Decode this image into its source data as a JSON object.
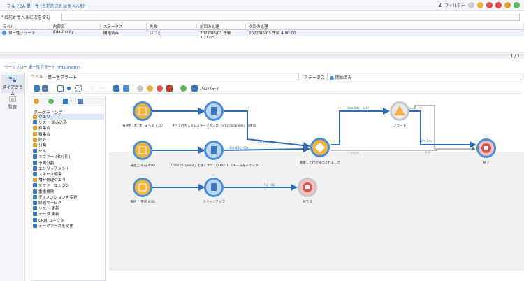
{
  "top": {
    "title": "フル FDA 単一性 (名前的またはラベル別)",
    "filter_label": "フィルター"
  },
  "filter": {
    "label": "名前かラベルに次を含む",
    "value": ""
  },
  "grid": {
    "columns": [
      "ラベル",
      "内部名",
      "ステータス",
      "失敗",
      "前回の処理",
      "次回の処理"
    ],
    "rows": [
      [
        "単一性アラート",
        "ffdaUnicity",
        "開始済み",
        "いいえ",
        "2022/06/01 午後 3:21:15",
        "2022/06/03 午前 4:00:00"
      ]
    ],
    "pagination": "1 / 1"
  },
  "workflow": {
    "breadcrumb": "ワークフロー 単一性アラート (ffdaUnicity)",
    "label_key": "ラベル",
    "label_value": "単一性アラート",
    "status_key": "ステータス",
    "status_value": "開始済み",
    "properties_label": "プロパティ"
  },
  "rail": {
    "diagram": "ダイアグラム",
    "audit": "監査"
  },
  "palette": {
    "title": "ターゲティング",
    "items": [
      {
        "label": "クエリ",
        "color": "#e0a030"
      },
      {
        "label": "リスト 読み込み",
        "color": "#3a78c0"
      },
      {
        "label": "和集合",
        "color": "#e0a030"
      },
      {
        "label": "積集合",
        "color": "#e0a030"
      },
      {
        "label": "除外",
        "color": "#e0a030"
      },
      {
        "label": "分割",
        "color": "#e0a030"
      },
      {
        "label": "セル",
        "color": "#3a78c0"
      },
      {
        "label": "オファー (セル別)",
        "color": "#3a78c0"
      },
      {
        "label": "予測分割",
        "color": "#3a78c0"
      },
      {
        "label": "エンリッチメント",
        "color": "#3a78c0"
      },
      {
        "label": "スキーマ編集",
        "color": "#3a78c0"
      },
      {
        "label": "増分処理クエリ",
        "color": "#e0a030"
      },
      {
        "label": "オファーエンジン",
        "color": "#3a78c0"
      },
      {
        "label": "重複排除",
        "color": "#3a78c0"
      },
      {
        "label": "ディメンションを変更",
        "color": "#3a78c0"
      },
      {
        "label": "繰越サービス",
        "color": "#3a78c0"
      },
      {
        "label": "リスト 更新",
        "color": "#3a78c0"
      },
      {
        "label": "データ 更新",
        "color": "#3a78c0"
      },
      {
        "label": "CRM コネクタ",
        "color": "#3a78c0"
      },
      {
        "label": "データソースを変更",
        "color": "#3a78c0"
      }
    ]
  },
  "nodes": {
    "sched1": "毎週月, 木, 金, 日 午前 4:00",
    "sched2": "毎週土 午前 4:00",
    "sched3": "毎週土 午前 4:00",
    "script1": "すべてのカスタムスキーマおよび「nms:recipient」を確認",
    "script2": "「nms:recipient」を除くすべての OOTB スキーマをチェック",
    "script3": "クリーンアップ",
    "orjoin": "重複した行が検出されました",
    "alert": "アラート",
    "end1": "終了",
    "end2": "終了 2"
  },
  "edges": {
    "e_alert": "2m 24s - はい",
    "e_join": "2m 24s - Ok",
    "e_script2": "4m 42s - Ok",
    "e_clean": "1s - Ok",
    "e_end1": "2m 24s",
    "e_err": "エラー",
    "e_no": "いいえ"
  },
  "colors": {
    "link": "#1a5fa8",
    "node_blue": "#4a90d9",
    "edge": "#2f6db5",
    "end_red": "#d9534f"
  }
}
